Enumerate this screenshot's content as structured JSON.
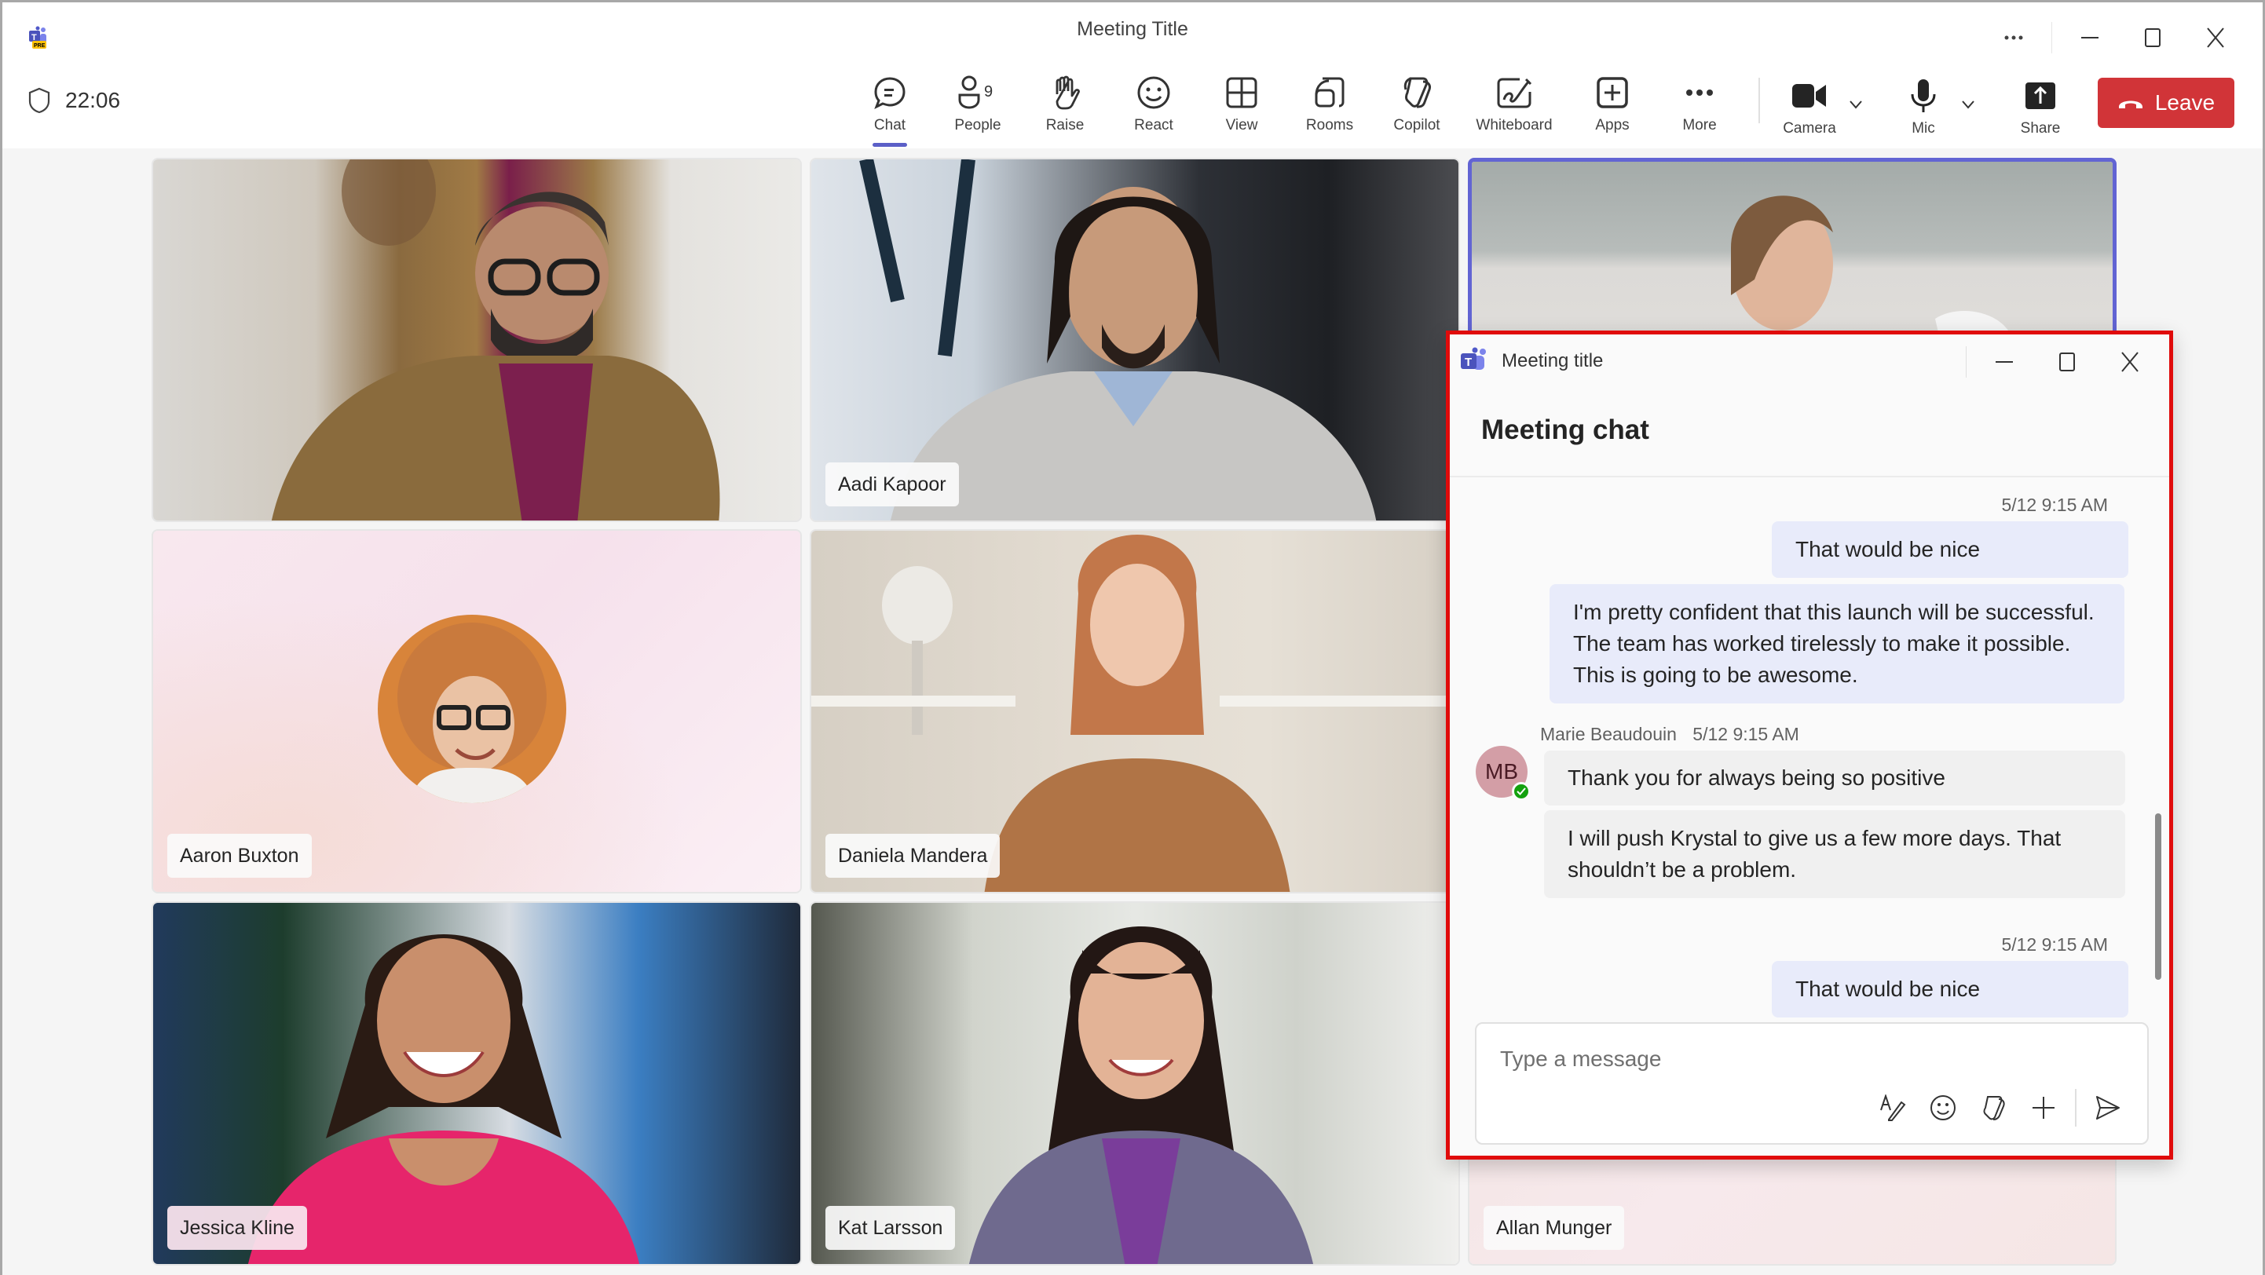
{
  "window": {
    "title": "Meeting Title",
    "app_badge": "PRE",
    "controls": {
      "more": "more-options",
      "minimize": "minimize",
      "maximize": "maximize",
      "close": "close"
    }
  },
  "call": {
    "elapsed": "22:06",
    "people_count": "9"
  },
  "toolbar": {
    "items": [
      {
        "id": "chat",
        "label": "Chat",
        "icon": "chat-icon",
        "active": true
      },
      {
        "id": "people",
        "label": "People",
        "icon": "people-icon"
      },
      {
        "id": "raise",
        "label": "Raise",
        "icon": "hand-icon"
      },
      {
        "id": "react",
        "label": "React",
        "icon": "emoji-icon"
      },
      {
        "id": "view",
        "label": "View",
        "icon": "grid-icon"
      },
      {
        "id": "rooms",
        "label": "Rooms",
        "icon": "rooms-icon"
      },
      {
        "id": "copilot",
        "label": "Copilot",
        "icon": "copilot-icon"
      },
      {
        "id": "whiteboard",
        "label": "Whiteboard",
        "icon": "whiteboard-icon"
      },
      {
        "id": "apps",
        "label": "Apps",
        "icon": "apps-plus-icon"
      },
      {
        "id": "more",
        "label": "More",
        "icon": "more-icon"
      },
      {
        "id": "camera",
        "label": "Camera",
        "icon": "camera-icon"
      },
      {
        "id": "mic",
        "label": "Mic",
        "icon": "mic-icon"
      },
      {
        "id": "share",
        "label": "Share",
        "icon": "share-icon"
      }
    ],
    "leave_label": "Leave",
    "leave_color": "#d13438",
    "accent": "#5b5fc7"
  },
  "participants": [
    {
      "name": "",
      "position": "top-left"
    },
    {
      "name": "Aadi Kapoor",
      "position": "top-center"
    },
    {
      "name": "",
      "position": "top-right",
      "selected": true
    },
    {
      "name": "Aaron Buxton",
      "position": "middle-left",
      "avatar_only": true
    },
    {
      "name": "Daniela Mandera",
      "position": "middle-center"
    },
    {
      "name": "",
      "position": "middle-right"
    },
    {
      "name": "Jessica Kline",
      "position": "bottom-left"
    },
    {
      "name": "Kat Larsson",
      "position": "bottom-center"
    },
    {
      "name": "Allan Munger",
      "position": "bottom-right"
    }
  ],
  "chat_window": {
    "title": "Meeting title",
    "header": "Meeting chat",
    "messages": [
      {
        "type": "timestamp",
        "text": "5/12 9:15 AM"
      },
      {
        "type": "me",
        "text": "That would be nice"
      },
      {
        "type": "me",
        "text": "I'm pretty confident that this launch will be successful. The team has worked tirelessly to make it possible. This is going to be awesome."
      },
      {
        "type": "sender",
        "name": "Marie Beaudouin",
        "time": "5/12 9:15 AM",
        "initials": "MB",
        "presence": "available"
      },
      {
        "type": "other",
        "text": "Thank you for always being so positive"
      },
      {
        "type": "other",
        "text": "I will push Krystal to give us a few more days. That shouldn’t be a problem."
      },
      {
        "type": "timestamp",
        "text": "5/12 9:15 AM"
      },
      {
        "type": "me",
        "text": "That would be nice"
      }
    ],
    "composer": {
      "placeholder": "Type a message",
      "tools": [
        "format-icon",
        "emoji-icon",
        "copilot-icon",
        "attach-plus-icon",
        "send-icon"
      ]
    }
  }
}
